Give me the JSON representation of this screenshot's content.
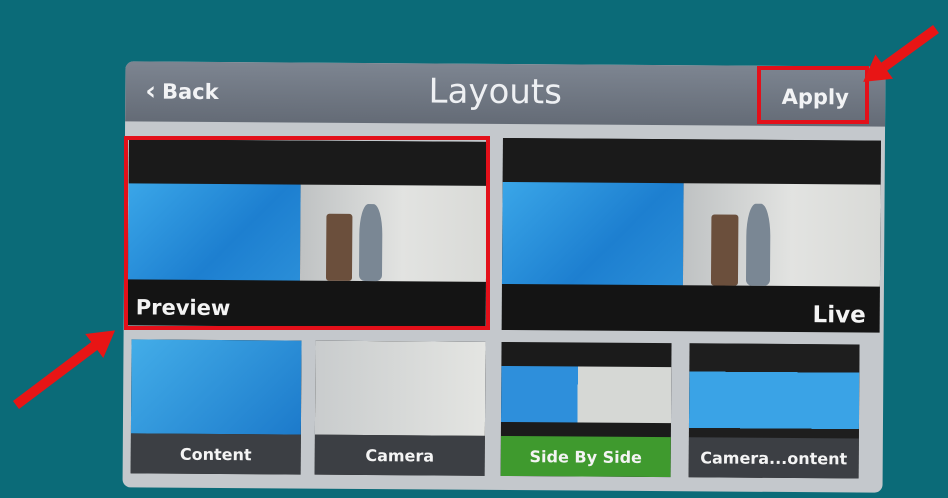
{
  "header": {
    "back_label": "Back",
    "title": "Layouts",
    "apply_label": "Apply"
  },
  "panes": {
    "preview_label": "Preview",
    "live_label": "Live"
  },
  "layouts": [
    {
      "label": "Content",
      "selected": false
    },
    {
      "label": "Camera",
      "selected": false
    },
    {
      "label": "Side By Side",
      "selected": true
    },
    {
      "label": "Camera...ontent",
      "selected": false
    }
  ],
  "colors": {
    "background": "#0b6b78",
    "highlight_box": "#e3101a",
    "selected_layout": "#3f9a2e",
    "topbar": "#6e7580"
  },
  "icons": {
    "back": "chevron-left-icon",
    "annotation": "red-arrow-icon"
  }
}
